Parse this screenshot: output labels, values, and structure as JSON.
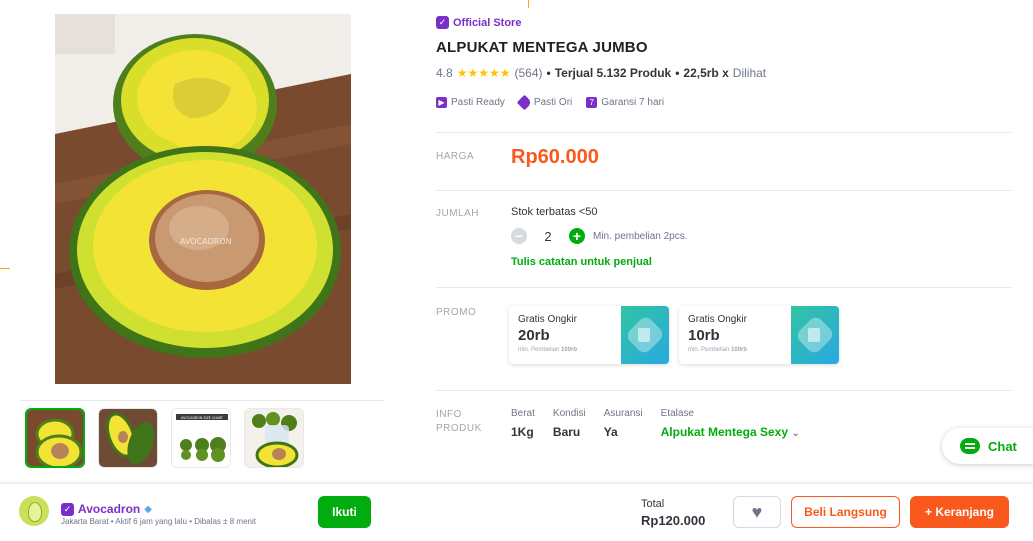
{
  "product": {
    "store_badge": "Official Store",
    "title": "ALPUKAT MENTEGA JUMBO",
    "rating": "4.8",
    "review_count": "(564)",
    "sold_label": "Terjual 5.132 Produk",
    "views_value": "22,5rb x",
    "views_suffix": "Dilihat",
    "guarantees": [
      "Pasti Ready",
      "Pasti Ori",
      "Garansi 7 hari"
    ],
    "image_watermark": "AVOCADRON"
  },
  "price": {
    "label": "HARGA",
    "value": "Rp60.000"
  },
  "quantity": {
    "label": "JUMLAH",
    "stock_note": "Stok terbatas <50",
    "value": "2",
    "min_note": "Min. pembelian 2pcs.",
    "note_link": "Tulis catatan untuk penjual"
  },
  "promo": {
    "label": "PROMO",
    "cards": [
      {
        "title": "Gratis Ongkir",
        "amount": "20rb",
        "min_prefix": "min. Pembelian",
        "min_value": "100rb"
      },
      {
        "title": "Gratis Ongkir",
        "amount": "10rb",
        "min_prefix": "min. Pembelian",
        "min_value": "100rb"
      }
    ]
  },
  "info": {
    "label_line1": "INFO",
    "label_line2": "PRODUK",
    "fields": [
      {
        "key": "Berat",
        "value": "1Kg"
      },
      {
        "key": "Kondisi",
        "value": "Baru"
      },
      {
        "key": "Asuransi",
        "value": "Ya"
      },
      {
        "key": "Etalase",
        "value": "Alpukat Mentega Sexy"
      }
    ]
  },
  "chat": {
    "label": "Chat"
  },
  "shop": {
    "name": "Avocadron",
    "subtitle": "Jakarta Barat • Aktif 6 jam yang lalu • Dibalas ± 8 menit",
    "follow_label": "Ikuti"
  },
  "checkout": {
    "total_label": "Total",
    "total_value": "Rp120.000",
    "buy_now_label": "Beli Langsung",
    "add_cart_label": "+ Keranjang"
  },
  "thumbnail_chart_title": "AVOCADRON SIZE CHART",
  "colors": {
    "primary_green": "#03ac0e",
    "price_orange": "#fa591d",
    "official_purple": "#7b2fc9",
    "star_yellow": "#ffc400"
  },
  "icons": [
    "official-store-icon",
    "star-icon",
    "pasti-ready-icon",
    "pasti-ori-icon",
    "garansi-icon",
    "minus-icon",
    "plus-icon",
    "free-shipping-icon",
    "chevron-down-icon",
    "chat-icon",
    "diamond-icon",
    "heart-icon"
  ]
}
